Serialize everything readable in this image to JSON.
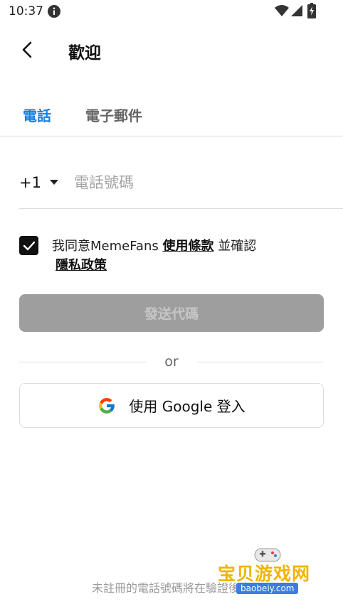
{
  "status_bar": {
    "time": "10:37"
  },
  "header": {
    "title": "歡迎"
  },
  "tabs": [
    {
      "label": "電話",
      "active": true
    },
    {
      "label": "電子郵件",
      "active": false
    }
  ],
  "phone": {
    "country_code": "+1",
    "placeholder": "電話號碼",
    "value": ""
  },
  "agreement": {
    "checked": true,
    "prefix": "我同意MemeFans",
    "terms_link": "使用條款",
    "middle": "並確認",
    "privacy_link": "隱私政策"
  },
  "send_code": {
    "label": "發送代碼",
    "enabled": false
  },
  "divider": {
    "label": "or"
  },
  "google_login": {
    "label": "使用 Google 登入"
  },
  "footer": {
    "note": "未註冊的電話號碼將在驗證後自"
  },
  "watermark": {
    "title": "宝贝游戏网",
    "url": "baobeiy.com"
  },
  "colors": {
    "accent": "#1a7fd6",
    "disabled_button": "#9e9e9e",
    "divider": "#dcdcdc"
  }
}
